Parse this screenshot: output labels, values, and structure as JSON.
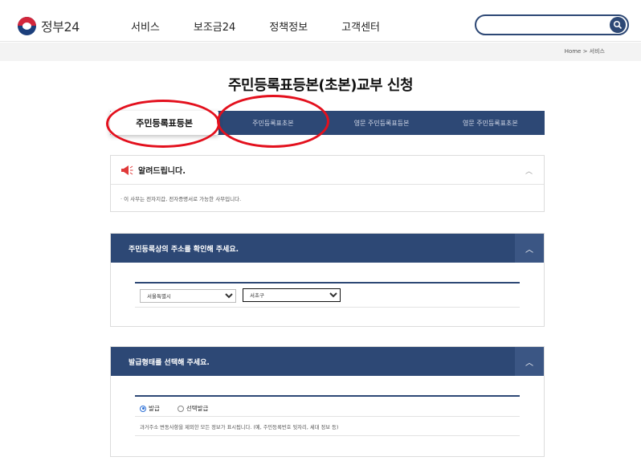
{
  "header": {
    "logo_text": "정부24",
    "nav": [
      "서비스",
      "보조금24",
      "정책정보",
      "고객센터"
    ],
    "search_placeholder": ""
  },
  "breadcrumb": "Home  >  서비스",
  "page_title": "주민등록표등본(초본)교부 신청",
  "tabs": [
    "주민등록표등본",
    "주민등록표초본",
    "영문 주민등록표등본",
    "영문 주민등록표초본"
  ],
  "notice": {
    "title": "알려드립니다.",
    "body": "· 이 사무는 전자지갑, 전자증명서로 가능한 사무입니다."
  },
  "address_section": {
    "title": "주민등록상의 주소를 확인해 주세요.",
    "city": "서울특별시",
    "district": "서초구"
  },
  "issue_section": {
    "title": "발급형태를 선택해 주세요.",
    "options": [
      "발급",
      "선택발급"
    ],
    "selected": "발급",
    "description": "과거주소 변동사항을 제외한 모든 정보가 표시됩니다. (예, 주민등록번호 뒷자리, 세대 정보 등)"
  },
  "colors": {
    "navy": "#2d4875",
    "annotation_red": "#e3101d"
  }
}
